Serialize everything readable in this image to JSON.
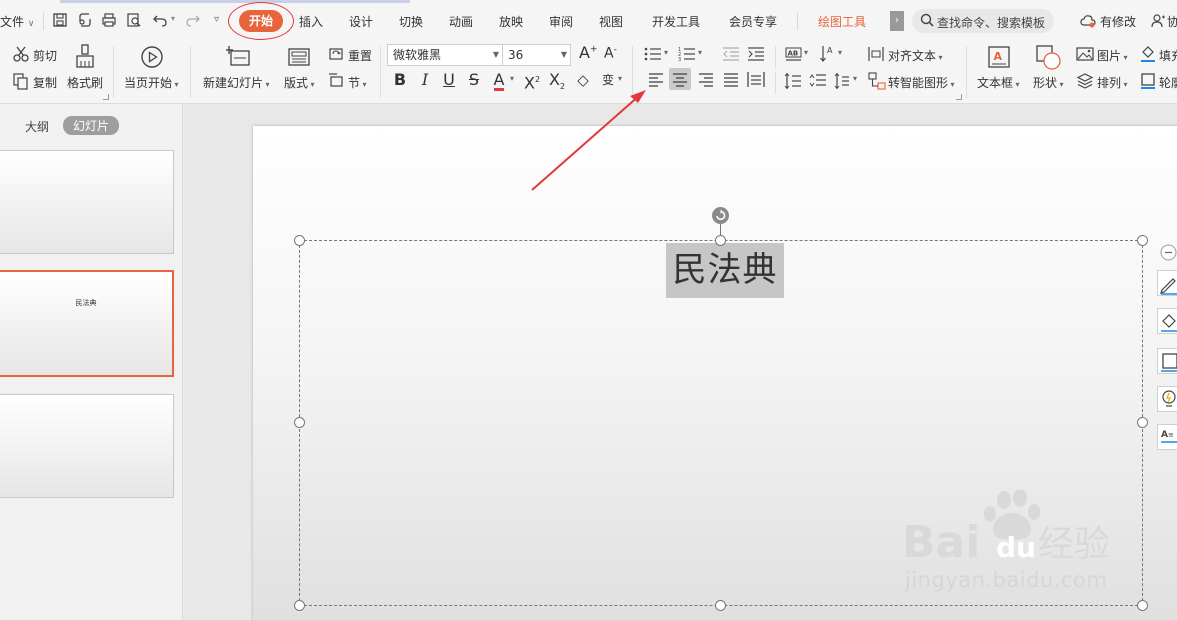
{
  "menubar": {
    "file_label": "文件",
    "tabs": [
      "开始",
      "插入",
      "设计",
      "切换",
      "动画",
      "放映",
      "审阅",
      "视图",
      "开发工具",
      "会员专享",
      "绘图工具"
    ],
    "active_tab": "开始",
    "search_placeholder": "查找命令、搜索模板",
    "has_changes_label": "有修改",
    "collab_label": "协"
  },
  "ribbon": {
    "clipboard": {
      "cut": "剪切",
      "copy": "复制",
      "format_painter": "格式刷"
    },
    "slideshow": {
      "from_current": "当页开始"
    },
    "slides": {
      "new_slide": "新建幻灯片",
      "layout": "版式",
      "reset": "重置",
      "section": "节"
    },
    "font": {
      "name": "微软雅黑",
      "size": "36"
    },
    "paragraph": {
      "align_text": "对齐文本",
      "convert_smartart": "转智能图形"
    },
    "drawing": {
      "text_box": "文本框",
      "shape": "形状",
      "picture": "图片",
      "arrange": "排列",
      "fill": "填充",
      "outline": "轮廓"
    }
  },
  "left_panel": {
    "tab_outline": "大纲",
    "tab_slides": "幻灯片",
    "slides": [
      {
        "title": ""
      },
      {
        "title": "民法典"
      },
      {
        "title": ""
      }
    ],
    "selected_index": 1
  },
  "slide": {
    "title_text": "民法典"
  },
  "watermark": {
    "brand": "Baidu经验",
    "url": "jingyan.baidu.com"
  },
  "colors": {
    "accent": "#e8643c",
    "annotation_red": "#e03a3a"
  }
}
